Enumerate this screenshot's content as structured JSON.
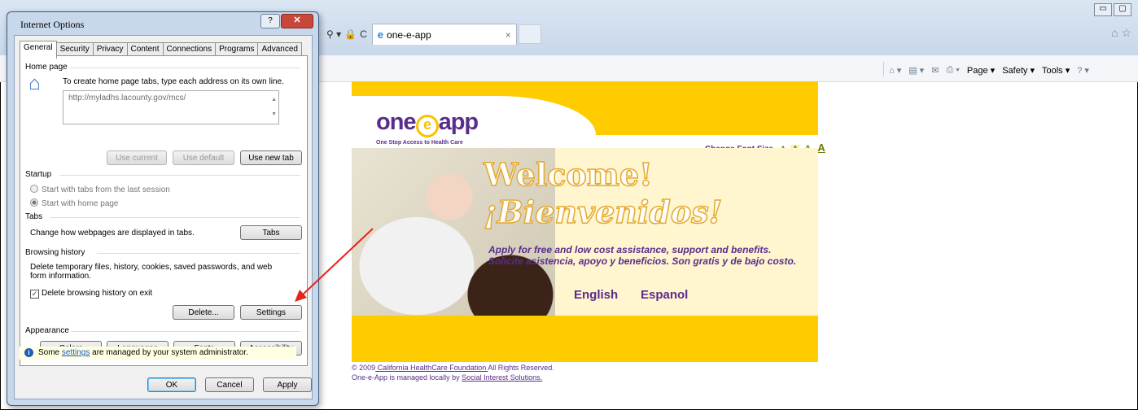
{
  "browser": {
    "tab_title": "one-e-app",
    "tab_close": "×",
    "address_tools": [
      "⚲ ▾",
      "🔒",
      "C"
    ],
    "window_buttons": [
      "▭",
      "▢"
    ],
    "home_star": "⌂ ☆",
    "command_bar": {
      "home": "⌂ ▾",
      "feeds": "▤ ▾",
      "mail": "✉",
      "print": "⎙ ▾",
      "page": "Page ▾",
      "safety": "Safety ▾",
      "tools": "Tools ▾",
      "help": "? ▾"
    }
  },
  "webpage": {
    "logo_prefix": "one",
    "logo_e": "e",
    "logo_suffix": "app",
    "tagline": "One Stop Access to Health Care",
    "font_size_label": "Change Font Size",
    "font_size_options": [
      "A",
      "A",
      "A",
      "A"
    ],
    "welcome": "Welcome!",
    "bienvenidos": "¡Bienvenidos!",
    "apply_en": "Apply for free and low cost assistance, support and benefits.",
    "apply_es": "Solicite asistencia, apoyo y beneficios. Son gratis y de bajo costo.",
    "lang_english": "English",
    "lang_espanol": "Espanol",
    "footer_line1_prefix": "© 2009",
    "footer_link1": " California HealthCare Foundation ",
    "footer_line1_suffix": "All Rights Reserved.",
    "footer_line2_prefix": "One-e-App is managed locally by ",
    "footer_link2": "Social Interest Solutions."
  },
  "dialog": {
    "title": "Internet Options",
    "help_btn": "?",
    "close_btn": "✕",
    "tabs": [
      "General",
      "Security",
      "Privacy",
      "Content",
      "Connections",
      "Programs",
      "Advanced"
    ],
    "home_page": {
      "heading": "Home page",
      "instruction": "To create home page tabs, type each address on its own line.",
      "url": "http://myladhs.lacounty.gov/mcs/",
      "use_current": "Use current",
      "use_default": "Use default",
      "use_new_tab": "Use new tab"
    },
    "startup": {
      "heading": "Startup",
      "option1": "Start with tabs from the last session",
      "option2": "Start with home page"
    },
    "tabs_section": {
      "heading": "Tabs",
      "description": "Change how webpages are displayed in tabs.",
      "button": "Tabs"
    },
    "browsing_history": {
      "heading": "Browsing history",
      "description_line1": "Delete temporary files, history, cookies, saved passwords, and web",
      "description_line2": "form information.",
      "checkbox_label": "Delete browsing history on exit",
      "checkbox_mark": "✓",
      "delete_btn": "Delete...",
      "settings_btn": "Settings"
    },
    "appearance": {
      "heading": "Appearance",
      "colors": "Colors",
      "languages": "Languages",
      "fonts": "Fonts",
      "accessibility": "Accessibility"
    },
    "info": {
      "icon": "i",
      "prefix": "Some ",
      "link": "settings",
      "suffix": " are managed by your system administrator."
    },
    "ok": "OK",
    "cancel": "Cancel",
    "apply": "Apply"
  },
  "colors": {
    "annotation_arrow": "#e8221b",
    "brand_yellow": "#ffcc00",
    "brand_purple": "#5a2d8c"
  }
}
